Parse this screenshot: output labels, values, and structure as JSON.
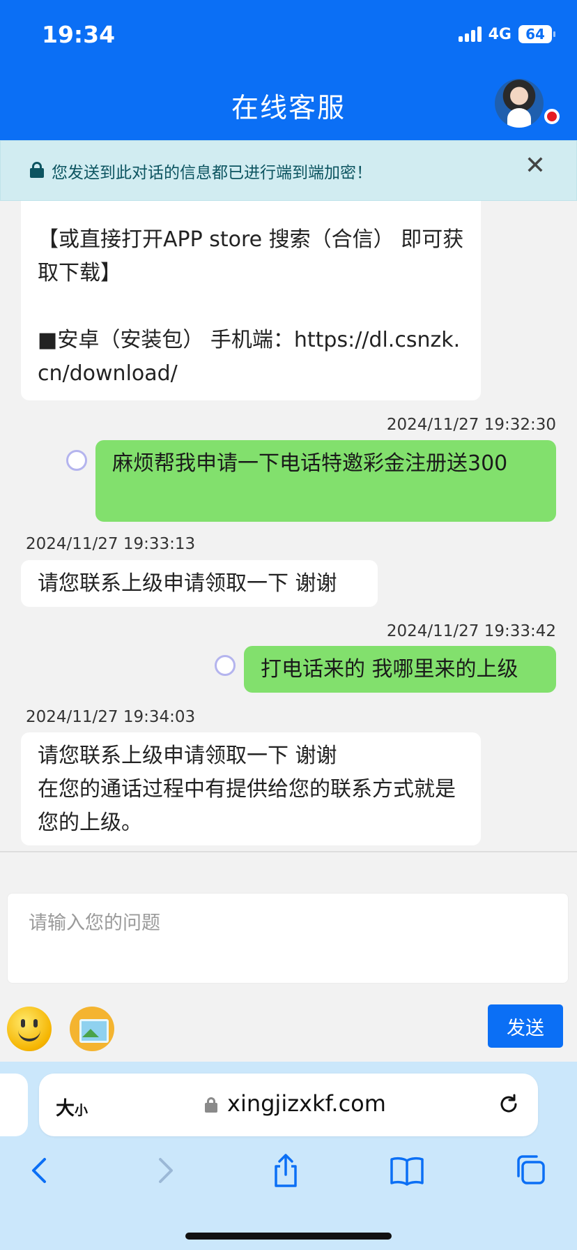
{
  "status_bar": {
    "time": "19:34",
    "network": "4G",
    "battery": "64"
  },
  "header": {
    "title": "在线客服"
  },
  "notice": {
    "text": "您发送到此对话的信息都已进行端到端加密！",
    "close": "✕"
  },
  "messages": {
    "m1": {
      "text": "【或直接打开APP store 搜索（合信） 即可获取下载】\n\n■安卓（安装包） 手机端：https://dl.csnzk.cn/download/"
    },
    "m2": {
      "time": "2024/11/27 19:32:30",
      "text": "麻烦帮我申请一下电话特邀彩金注册送300"
    },
    "m3": {
      "time": "2024/11/27 19:33:13",
      "text": "请您联系上级申请领取一下 谢谢"
    },
    "m4": {
      "time": "2024/11/27 19:33:42",
      "text": "打电话来的 我哪里来的上级"
    },
    "m5": {
      "time": "2024/11/27 19:34:03",
      "text": "请您联系上级申请领取一下 谢谢\n在您的通话过程中有提供给您的联系方式就是您的上级。"
    }
  },
  "composer": {
    "placeholder": "请输入您的问题",
    "send_label": "发送"
  },
  "browser": {
    "aa_big": "大",
    "aa_small": "小",
    "url": "xingjizxkf.com"
  },
  "colors": {
    "header": "#0b6ff5",
    "user_bubble": "#82e06d",
    "notice_bg": "#d1ecf1"
  }
}
